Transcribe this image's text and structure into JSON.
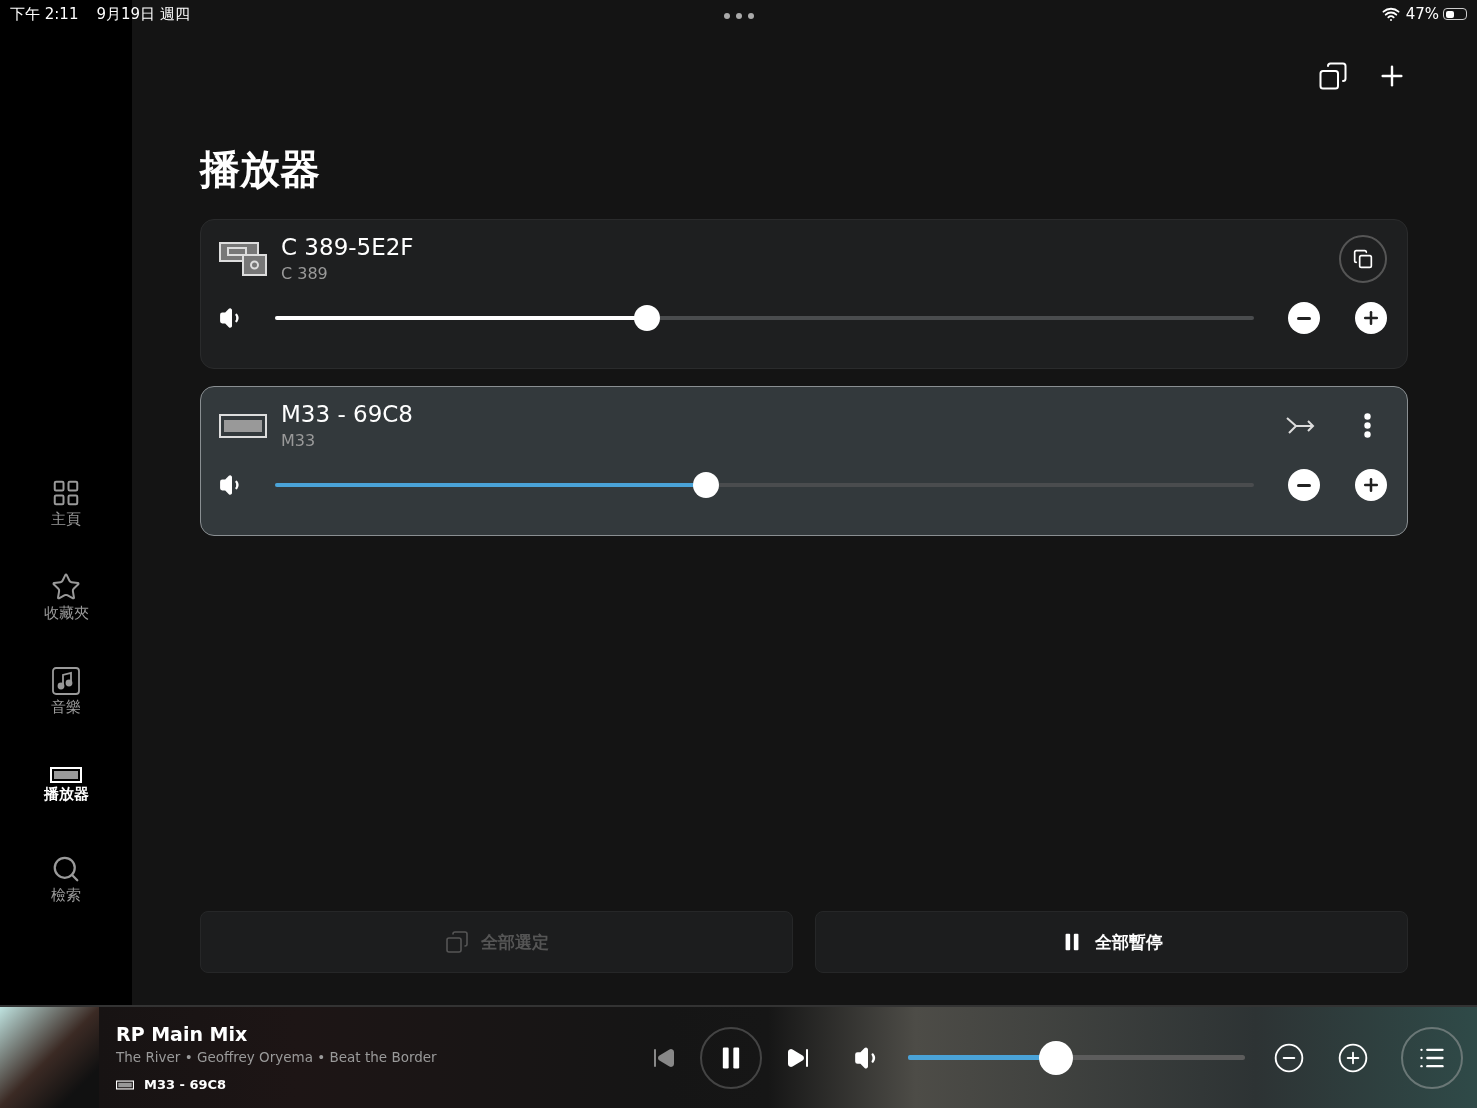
{
  "status_bar": {
    "time": "下午 2:11",
    "date": "9月19日 週四",
    "battery": "47%"
  },
  "sidebar": {
    "items": [
      {
        "kind": "home",
        "label": "主頁",
        "selected": false
      },
      {
        "kind": "favorites",
        "label": "收藏夾",
        "selected": false
      },
      {
        "kind": "music",
        "label": "音樂",
        "selected": false
      },
      {
        "kind": "players",
        "label": "播放器",
        "selected": true
      },
      {
        "kind": "search",
        "label": "檢索",
        "selected": false
      }
    ]
  },
  "page": {
    "title": "播放器"
  },
  "players": [
    {
      "kind": "combo",
      "name": "C 389-5E2F",
      "model": "C 389",
      "selected": false,
      "level": 0.38
    },
    {
      "kind": "bar",
      "name": "M33 - 69C8",
      "model": "M33",
      "selected": true,
      "level": 0.44
    }
  ],
  "actions": [
    {
      "kind": "select",
      "label": "全部選定",
      "disabled": true
    },
    {
      "kind": "pause",
      "label": "全部暫停",
      "disabled": false
    }
  ],
  "now_playing": {
    "title": "RP Main Mix",
    "subtitle": "The River • Geoffrey Oryema • Beat the Border",
    "player": "M33 - 69C8",
    "playing": true,
    "level": 0.44
  }
}
